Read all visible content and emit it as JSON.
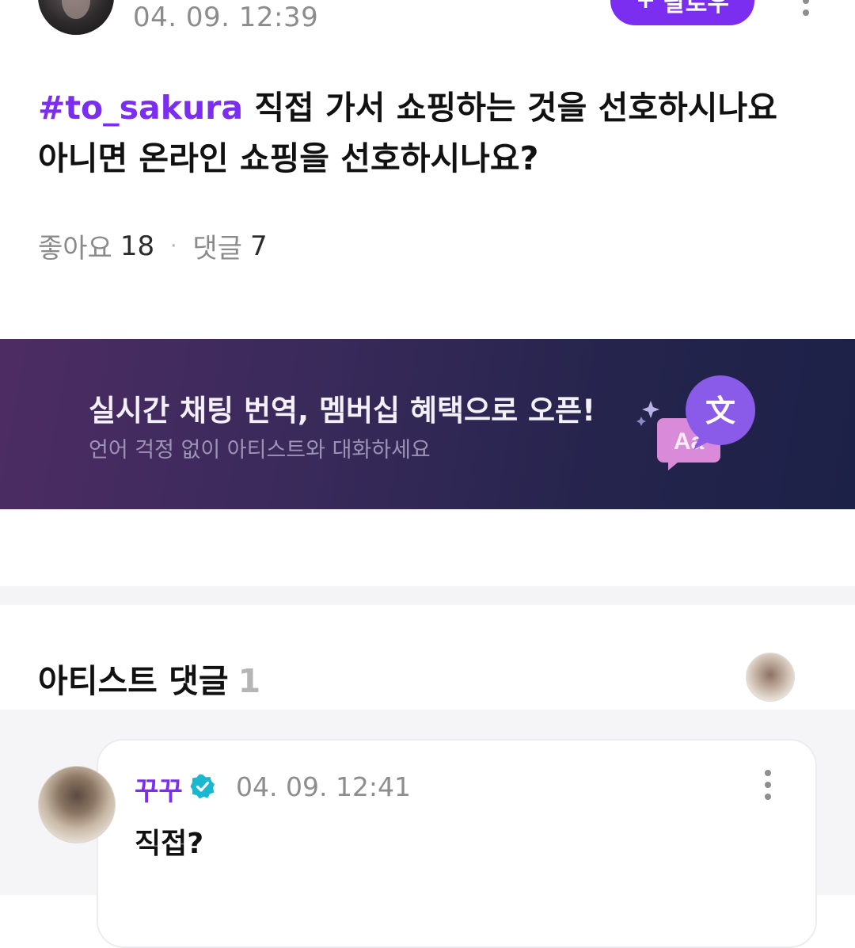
{
  "post": {
    "time": "04. 09. 12:39",
    "follow_label": "팔로우",
    "hashtag": "#to_sakura",
    "text_line1": " 직접 가서 쇼핑하는 것을 선호하시나요",
    "text_line2": "아니면 온라인 쇼핑을 선호하시나요?",
    "likes_label": "좋아요",
    "likes_count": "18",
    "comments_label": "댓글",
    "comments_count": "7"
  },
  "banner": {
    "title": "실시간 채팅 번역, 멤버십 혜택으로 오픈!",
    "subtitle": "언어 걱정 없이 아티스트와 대화하세요",
    "icon_text_a": "Aa",
    "icon_text_b": "文"
  },
  "artist_comments": {
    "title": "아티스트 댓글",
    "count": "1",
    "items": [
      {
        "author": "꾸꾸",
        "time": "04. 09. 12:41",
        "text": "직접?"
      }
    ]
  },
  "colors": {
    "accent": "#7c2ef0",
    "verified": "#19b7d0"
  }
}
